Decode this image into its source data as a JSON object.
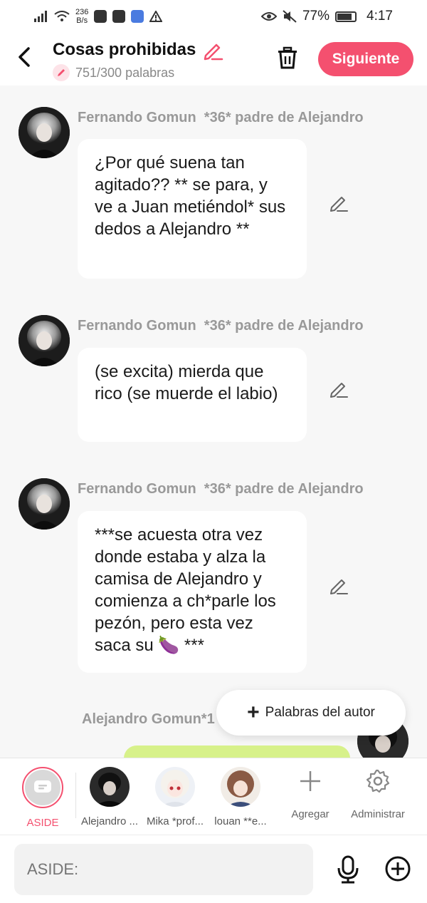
{
  "status_bar": {
    "net_speed_value": "236",
    "net_speed_unit": "B/s",
    "battery": "77%",
    "time": "4:17"
  },
  "header": {
    "title": "Cosas prohibidas",
    "word_count": "751/300 palabras",
    "next_label": "Siguiente"
  },
  "messages": [
    {
      "sender": "Fernando Gomun",
      "role": "*36* padre de Alejandro",
      "text": "¿Por qué suena tan agitado?? ** se para, y ve a Juan metiéndol* sus dedos a Alejandro **"
    },
    {
      "sender": "Fernando Gomun",
      "role": "*36* padre de Alejandro",
      "text": "(se excita) mierda que rico (se muerde el labio)"
    },
    {
      "sender": "Fernando Gomun",
      "role": "*36* padre de Alejandro",
      "text": "***se acuesta otra vez donde estaba y alza la camisa de Alejandro y comienza a ch*parle los pezón, pero esta vez saca su 🍆 ***"
    },
    {
      "sender": "Alejandro Gomun*1",
      "role": "",
      "text": ""
    }
  ],
  "author_words_label": "Palabras del autor",
  "characters": [
    {
      "name": "ASIDE"
    },
    {
      "name": "Alejandro ..."
    },
    {
      "name": "Mika *prof..."
    },
    {
      "name": "louan **e..."
    }
  ],
  "actions": {
    "add_label": "Agregar",
    "manage_label": "Administrar"
  },
  "input": {
    "placeholder": "ASIDE:"
  },
  "colors": {
    "accent": "#f4506f",
    "green_bubble": "#d7f18a"
  }
}
